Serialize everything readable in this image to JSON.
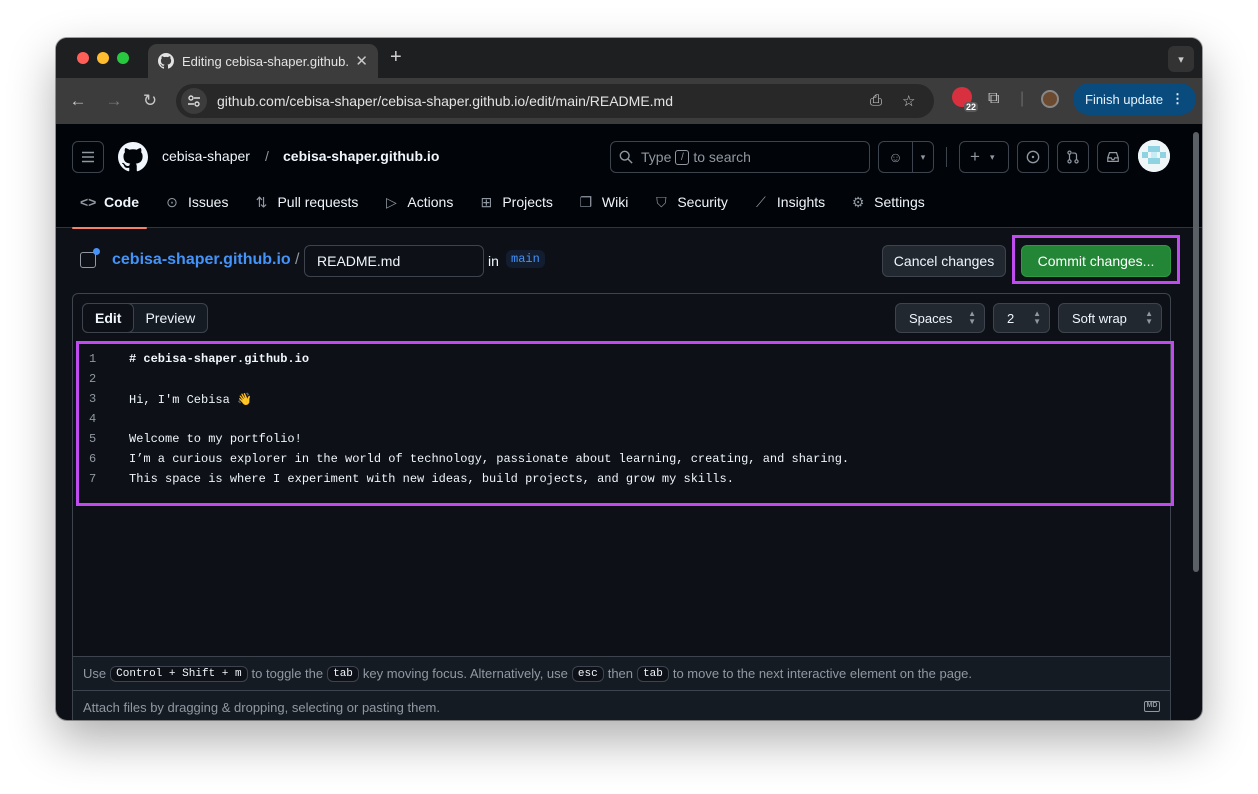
{
  "browser": {
    "tab_title": "Editing cebisa-shaper.github.io",
    "url": "github.com/cebisa-shaper/cebisa-shaper.github.io/edit/main/README.md",
    "extension_badge": "22",
    "finish_update_label": "Finish update"
  },
  "header": {
    "owner": "cebisa-shaper",
    "separator": "/",
    "repo": "cebisa-shaper.github.io",
    "search_prefix": "Type",
    "search_key": "/",
    "search_suffix": "to search"
  },
  "nav": {
    "items": [
      {
        "label": "Code",
        "icon": "code-icon",
        "active": true
      },
      {
        "label": "Issues",
        "icon": "issue-icon"
      },
      {
        "label": "Pull requests",
        "icon": "pull-request-icon"
      },
      {
        "label": "Actions",
        "icon": "play-icon"
      },
      {
        "label": "Projects",
        "icon": "table-icon"
      },
      {
        "label": "Wiki",
        "icon": "book-icon"
      },
      {
        "label": "Security",
        "icon": "shield-icon"
      },
      {
        "label": "Insights",
        "icon": "graph-icon"
      },
      {
        "label": "Settings",
        "icon": "gear-icon"
      }
    ]
  },
  "editor": {
    "repo_link": "cebisa-shaper.github.io",
    "separator": "/",
    "filename": "README.md",
    "in_label": "in",
    "branch": "main",
    "cancel_label": "Cancel changes",
    "commit_label": "Commit changes...",
    "tabs": [
      "Edit",
      "Preview"
    ],
    "indent_mode": "Spaces",
    "indent_size": "2",
    "wrap_mode": "Soft wrap",
    "lines": [
      {
        "n": "1",
        "text": "# cebisa-shaper.github.io"
      },
      {
        "n": "2",
        "text": ""
      },
      {
        "n": "3",
        "text": "Hi, I'm Cebisa 👋"
      },
      {
        "n": "4",
        "text": ""
      },
      {
        "n": "5",
        "text": "Welcome to my portfolio!"
      },
      {
        "n": "6",
        "text": "I’m a curious explorer in the world of technology, passionate about learning, creating, and sharing."
      },
      {
        "n": "7",
        "text": "This space is where I experiment with new ideas, build projects, and grow my skills."
      }
    ],
    "hint": {
      "use": "Use",
      "shortcut": "Control + Shift + m",
      "part1": "to toggle the",
      "tab_key": "tab",
      "part2": "key moving focus. Alternatively, use",
      "esc_key": "esc",
      "part3": "then",
      "part4": "to move to the next interactive element on the page."
    },
    "attach_text": "Attach files by dragging & dropping, selecting or pasting them.",
    "markdown_icon_text": "MD"
  },
  "colors": {
    "highlight": "#c04cf0",
    "commit_green": "#238636",
    "link_blue": "#4493f8"
  }
}
